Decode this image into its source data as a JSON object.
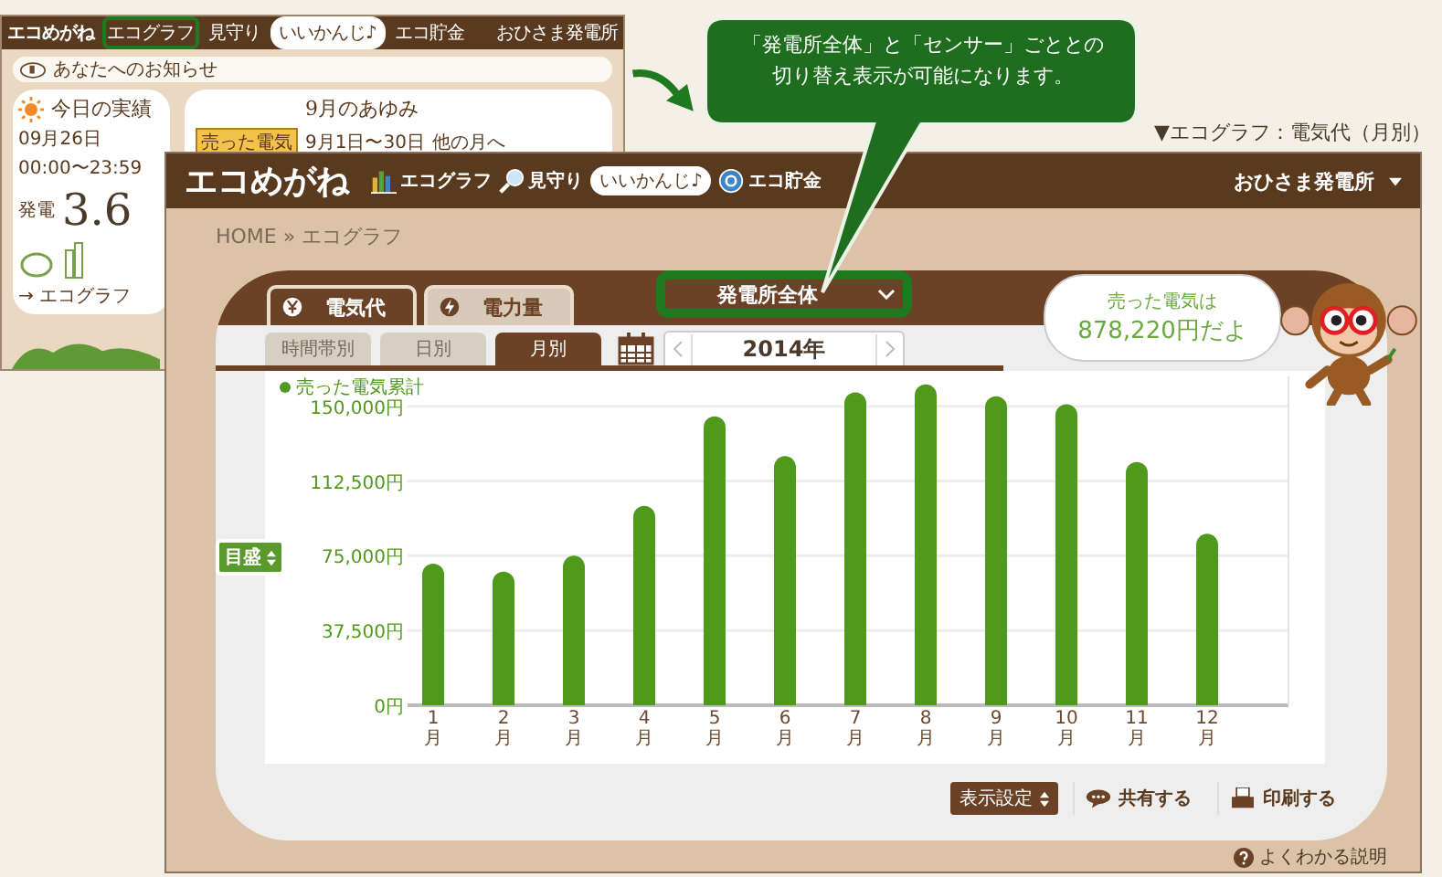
{
  "thumbnail": {
    "logo": "エコめがね",
    "nav": [
      {
        "kind": "graph",
        "label": "エコグラフ",
        "highlighted": true
      },
      {
        "kind": "watch",
        "label": "見守り",
        "highlighted": false
      },
      {
        "kind": "badge",
        "label": "いいかんじ♪",
        "highlighted": false
      },
      {
        "kind": "savings",
        "label": "エコ貯金",
        "highlighted": false
      }
    ],
    "plant_menu": "おひさま発電所",
    "notice": "あなたへのお知らせ",
    "today": {
      "title": "今日の実績",
      "date": "09月26日",
      "time_range": "00:00〜23:59",
      "metric_label": "発電",
      "metric_value": "3.6",
      "link": "→ エコグラフ"
    },
    "month": {
      "title": "9月のあゆみ",
      "sign": "売った電気",
      "range": "9月1日〜30日",
      "other_link": "他の月へ"
    }
  },
  "caption": "▼エコグラフ：電気代（月別）",
  "callout": {
    "lines": [
      "「発電所全体」と「センサー」ごととの",
      "切り替え表示が可能になります。"
    ]
  },
  "window": {
    "logo": "エコめがね",
    "nav": [
      {
        "kind": "graph",
        "label": "エコグラフ"
      },
      {
        "kind": "watch",
        "label": "見守り"
      },
      {
        "kind": "badge",
        "label": "いいかんじ♪"
      },
      {
        "kind": "savings",
        "label": "エコ貯金"
      }
    ],
    "plant_menu": "おひさま発電所",
    "breadcrumb": "HOME » エコグラフ",
    "tabs": [
      {
        "kind": "yen",
        "label": "電気代",
        "selected": true
      },
      {
        "kind": "power",
        "label": "電力量",
        "selected": false
      }
    ],
    "scope_select": {
      "value": "発電所全体",
      "highlighted": true
    },
    "period_tabs": [
      {
        "label": "時間帯別",
        "selected": false
      },
      {
        "label": "日別",
        "selected": false
      },
      {
        "label": "月別",
        "selected": true
      }
    ],
    "year": "2014年",
    "bubble": {
      "line1": "売った電気は",
      "line2": "878,220円だよ"
    },
    "scale_button": "目盛",
    "chart_data": {
      "type": "bar",
      "categories": [
        "1月",
        "2月",
        "3月",
        "4月",
        "5月",
        "6月",
        "7月",
        "8月",
        "9月",
        "10月",
        "11月",
        "12月"
      ],
      "series": [
        {
          "name": "売った電気累計",
          "color": "#4f9a1c",
          "values": [
            71000,
            67000,
            75000,
            100000,
            145000,
            125000,
            157000,
            161000,
            155000,
            151000,
            122000,
            86000
          ]
        }
      ],
      "grid": true,
      "ylim": [
        0,
        165000
      ],
      "yticks": [
        {
          "value": 0,
          "label": "0円"
        },
        {
          "value": 37500,
          "label": "37,500円"
        },
        {
          "value": 75000,
          "label": "75,000円"
        },
        {
          "value": 112500,
          "label": "112,500円"
        },
        {
          "value": 150000,
          "label": "150,000円"
        }
      ]
    },
    "toolbar": [
      {
        "kind": "select",
        "label": "表示設定"
      },
      {
        "kind": "share",
        "label": "共有する"
      },
      {
        "kind": "print",
        "label": "印刷する"
      }
    ],
    "help_link": "よくわかる説明"
  }
}
